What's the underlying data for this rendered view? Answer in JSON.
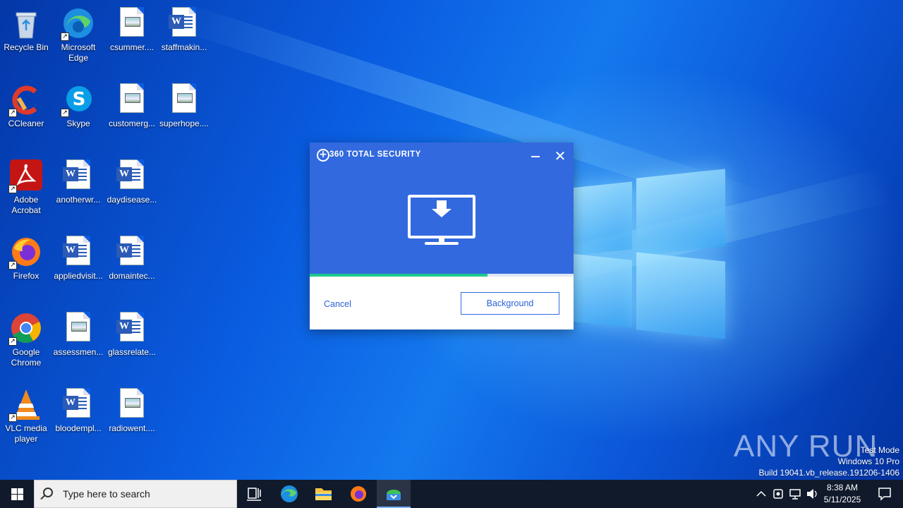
{
  "desktop_icons": [
    {
      "label": "Recycle Bin",
      "icon": "recycle-bin-icon"
    },
    {
      "label": "Microsoft Edge",
      "icon": "edge-icon"
    },
    {
      "label": "csummer....",
      "icon": "image-file-icon"
    },
    {
      "label": "staffmakin...",
      "icon": "word-doc-icon"
    },
    {
      "label": "CCleaner",
      "icon": "ccleaner-icon"
    },
    {
      "label": "Skype",
      "icon": "skype-icon"
    },
    {
      "label": "customerg...",
      "icon": "image-file-icon"
    },
    {
      "label": "superhope....",
      "icon": "image-file-icon"
    },
    {
      "label": "Adobe Acrobat",
      "icon": "acrobat-icon"
    },
    {
      "label": "anotherwr...",
      "icon": "word-doc-icon"
    },
    {
      "label": "daydisease...",
      "icon": "word-doc-icon"
    },
    {
      "label": "Firefox",
      "icon": "firefox-icon"
    },
    {
      "label": "appliedvisit...",
      "icon": "word-doc-icon"
    },
    {
      "label": "domaintec...",
      "icon": "word-doc-icon"
    },
    {
      "label": "Google Chrome",
      "icon": "chrome-icon"
    },
    {
      "label": "assessmen...",
      "icon": "image-file-icon"
    },
    {
      "label": "glassrelate...",
      "icon": "word-doc-icon"
    },
    {
      "label": "VLC media player",
      "icon": "vlc-icon"
    },
    {
      "label": "bloodempl...",
      "icon": "word-doc-icon"
    },
    {
      "label": "radiowent....",
      "icon": "image-file-icon"
    }
  ],
  "dialog": {
    "title": "360 TOTAL SECURITY",
    "progress": 0.675,
    "cancel_label": "Cancel",
    "background_label": "Background"
  },
  "watermark": "ANY RUN",
  "system": {
    "test_mode": "Test Mode",
    "edition": "Windows 10 Pro",
    "build": "Build 19041.vb_release.191206-1406"
  },
  "taskbar": {
    "search_placeholder": "Type here to search",
    "time": "8:38 AM",
    "date": "5/11/2025"
  },
  "colors": {
    "dialog_header": "#3269de",
    "progress": "#1fc98c",
    "taskbar": "#101a2b"
  }
}
